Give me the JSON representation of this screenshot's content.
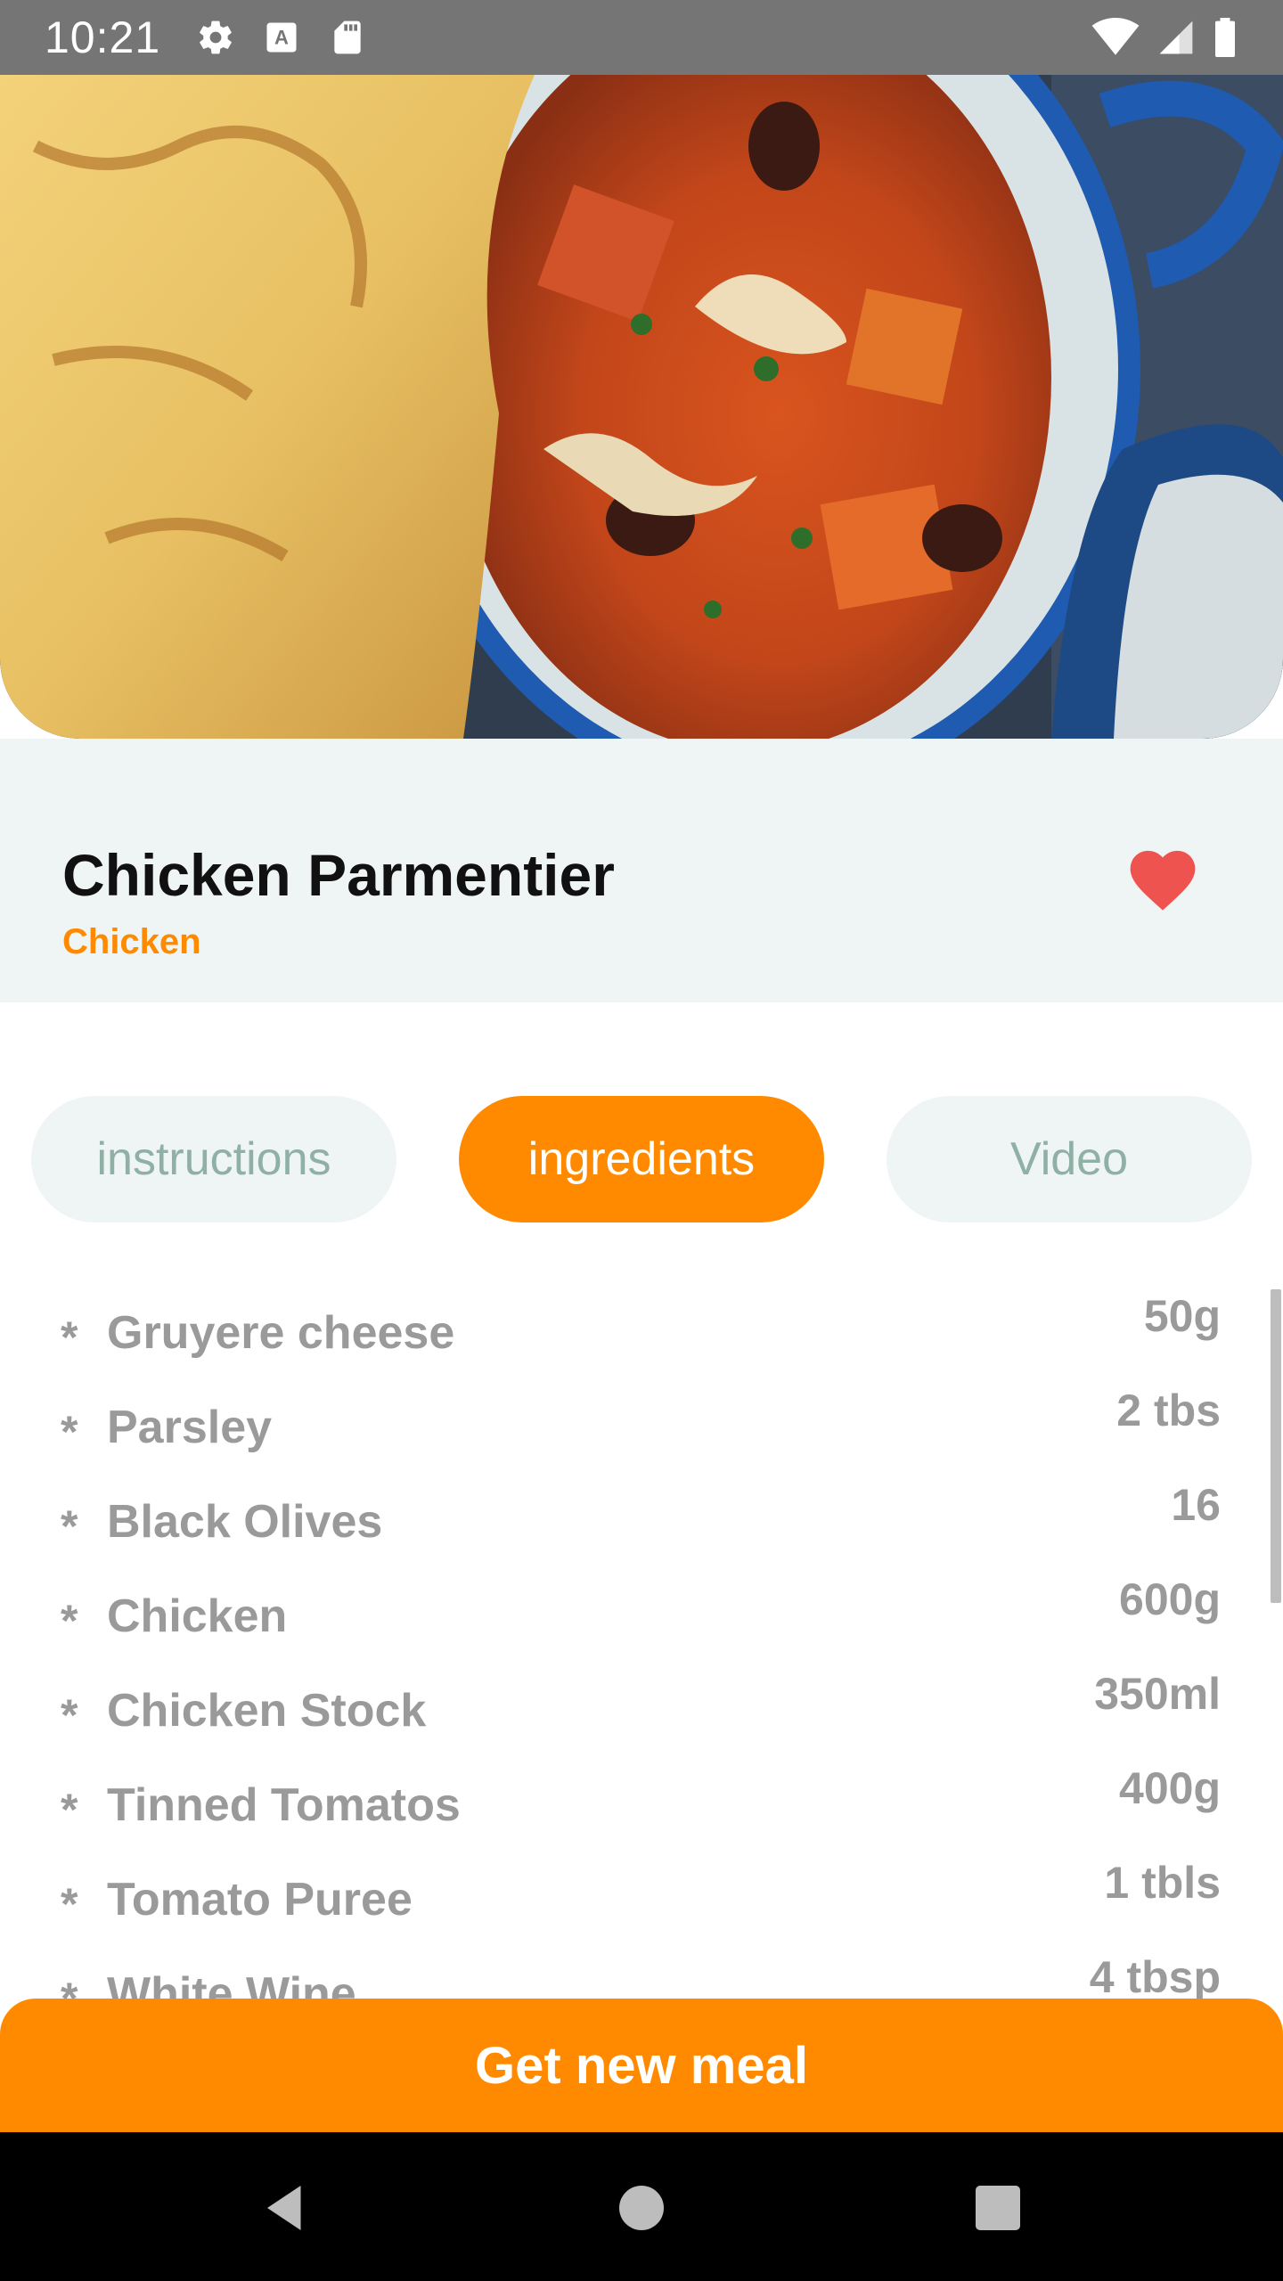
{
  "status_bar": {
    "time": "10:21",
    "left_icons": [
      "gear-icon",
      "keyboard-a-icon",
      "sd-card-icon"
    ],
    "right_icons": [
      "wifi-icon",
      "signal-icon",
      "battery-icon"
    ]
  },
  "hero": {
    "image_description_icon": "meal-photo"
  },
  "meal": {
    "title": "Chicken Parmentier",
    "category": "Chicken",
    "favorite_icon": "heart-icon",
    "favorite_color": "#ef5350"
  },
  "tabs": [
    {
      "label": "instructions",
      "active": false
    },
    {
      "label": "ingredients",
      "active": true
    },
    {
      "label": "Video",
      "active": false
    }
  ],
  "ingredients": [
    {
      "name": "Gruyere cheese",
      "measure": "50g"
    },
    {
      "name": "Parsley",
      "measure": "2 tbs"
    },
    {
      "name": "Black Olives",
      "measure": "16"
    },
    {
      "name": "Chicken",
      "measure": "600g"
    },
    {
      "name": "Chicken Stock",
      "measure": "350ml"
    },
    {
      "name": "Tinned Tomatos",
      "measure": "400g"
    },
    {
      "name": "Tomato Puree",
      "measure": "1 tbls"
    },
    {
      "name": "White Wine",
      "measure": "4 tbsp"
    }
  ],
  "ingredient_bullet": "*",
  "bottom_button": {
    "label": "Get new meal"
  },
  "colors": {
    "accent": "#ff8a00",
    "header_bg": "#eff4f4",
    "muted_text": "#9a9a9a",
    "tab_inactive_text": "#8fb0a4"
  },
  "nav": {
    "icons": [
      "back-icon",
      "home-icon",
      "recents-icon"
    ]
  }
}
